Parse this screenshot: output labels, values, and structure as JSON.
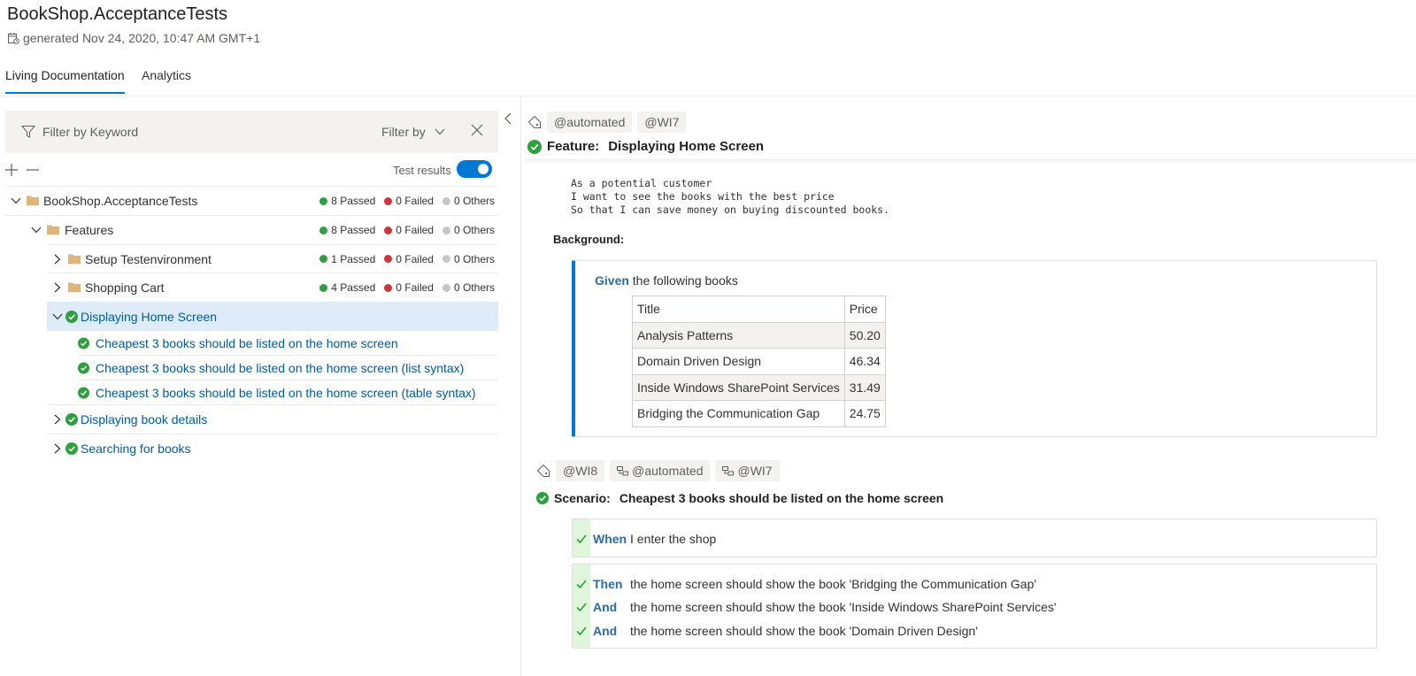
{
  "header": {
    "title": "BookShop.AcceptanceTests",
    "generated": "generated Nov 24, 2020, 10:47 AM GMT+1"
  },
  "tabs": [
    {
      "label": "Living Documentation",
      "active": true
    },
    {
      "label": "Analytics",
      "active": false
    }
  ],
  "filter": {
    "placeholder": "Filter by Keyword",
    "filter_by_label": "Filter by"
  },
  "tree_tools": {
    "toggle_label": "Test results",
    "toggle_on": true
  },
  "status_colors": {
    "passed": "#2e9e3f",
    "failed": "#d13438",
    "others": "#c8c6c4",
    "accent": "#0078d4"
  },
  "tree": {
    "root": {
      "label": "BookShop.AcceptanceTests",
      "passed": "8 Passed",
      "failed": "0 Failed",
      "others": "0 Others"
    },
    "features": {
      "label": "Features",
      "passed": "8 Passed",
      "failed": "0 Failed",
      "others": "0 Others"
    },
    "setup": {
      "label": "Setup Testenvironment",
      "passed": "1 Passed",
      "failed": "0 Failed",
      "others": "0 Others"
    },
    "cart": {
      "label": "Shopping Cart",
      "passed": "4 Passed",
      "failed": "0 Failed",
      "others": "0 Others"
    },
    "home": {
      "label": "Displaying Home Screen"
    },
    "scenarios": [
      {
        "label": "Cheapest 3 books should be listed on the home screen"
      },
      {
        "label": "Cheapest 3 books should be listed on the home screen (list syntax)"
      },
      {
        "label": "Cheapest 3 books should be listed on the home screen (table syntax)"
      }
    ],
    "details": {
      "label": "Displaying book details"
    },
    "search": {
      "label": "Searching for books"
    }
  },
  "feature": {
    "tags": [
      "@automated",
      "@WI7"
    ],
    "keyword": "Feature:",
    "title": "Displaying Home Screen",
    "description": [
      "As a potential customer",
      "I want to see the books with the best price",
      "So that I can save money on buying discounted books."
    ],
    "background_label": "Background:",
    "background_step": {
      "keyword": "Given",
      "text": "the following books"
    },
    "books_table": {
      "headers": [
        "Title",
        "Price"
      ],
      "rows": [
        [
          "Analysis Patterns",
          "50.20"
        ],
        [
          "Domain Driven Design",
          "46.34"
        ],
        [
          "Inside Windows SharePoint Services",
          "31.49"
        ],
        [
          "Bridging the Communication Gap",
          "24.75"
        ]
      ]
    }
  },
  "scenario": {
    "tags": [
      "@WI8",
      "@automated",
      "@WI7"
    ],
    "keyword": "Scenario:",
    "title": "Cheapest 3 books should be listed on the home screen",
    "when": {
      "keyword": "When",
      "text": "I enter the shop"
    },
    "then_steps": [
      {
        "keyword": "Then",
        "text": "the home screen should show the book 'Bridging the Communication Gap'"
      },
      {
        "keyword": "And",
        "text": "the home screen should show the book 'Inside Windows SharePoint Services'"
      },
      {
        "keyword": "And",
        "text": "the home screen should show the book 'Domain Driven Design'"
      }
    ]
  }
}
